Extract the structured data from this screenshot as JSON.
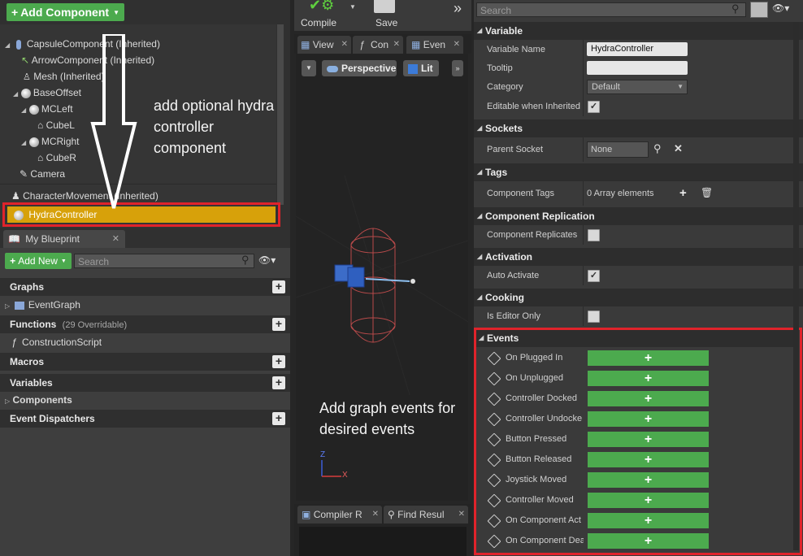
{
  "components_panel": {
    "add_component_label": "Add Component",
    "tree": [
      {
        "label": "CapsuleComponent (Inherited)",
        "icon": "capsule-icon"
      },
      {
        "label": "ArrowComponent (Inherited)",
        "icon": "arrow-icon"
      },
      {
        "label": "Mesh (Inherited)",
        "icon": "skeletal-mesh-icon"
      },
      {
        "label": "BaseOffset",
        "icon": "scene-icon"
      },
      {
        "label": "MCLeft",
        "icon": "motion-controller-icon"
      },
      {
        "label": "CubeL",
        "icon": "static-mesh-icon"
      },
      {
        "label": "MCRight",
        "icon": "motion-controller-icon"
      },
      {
        "label": "CubeR",
        "icon": "static-mesh-icon"
      },
      {
        "label": "Camera",
        "icon": "camera-icon"
      },
      {
        "label": "CharacterMovement (Inherited)",
        "icon": "movement-icon"
      },
      {
        "label": "HydraController",
        "icon": "hydra-icon",
        "selected": true
      }
    ]
  },
  "annotations": {
    "top": "add optional hydra controller component",
    "bottom": "Add graph events for desired events"
  },
  "my_blueprint": {
    "tab_label": "My Blueprint",
    "add_new_label": "Add New",
    "search_placeholder": "Search",
    "sections": {
      "graphs": "Graphs",
      "event_graph": "EventGraph",
      "functions": "Functions",
      "functions_count": "(29 Overridable)",
      "construction_script": "ConstructionScript",
      "macros": "Macros",
      "variables": "Variables",
      "components": "Components",
      "event_dispatchers": "Event Dispatchers"
    }
  },
  "toolbar": {
    "compile_label": "Compile",
    "save_label": "Save"
  },
  "viewport": {
    "tabs": [
      "View",
      "Con",
      "Even"
    ],
    "perspective_label": "Perspective",
    "lit_label": "Lit",
    "axis_z": "Z",
    "axis_x": "X"
  },
  "bottom_tabs": {
    "compiler_label": "Compiler R",
    "find_label": "Find Resul"
  },
  "details": {
    "search_placeholder": "Search",
    "variable": {
      "header": "Variable",
      "name_label": "Variable Name",
      "name_value": "HydraController",
      "tooltip_label": "Tooltip",
      "tooltip_value": "",
      "category_label": "Category",
      "category_value": "Default",
      "editable_label": "Editable when Inherited",
      "editable_checked": true
    },
    "sockets": {
      "header": "Sockets",
      "parent_socket_label": "Parent Socket",
      "parent_socket_value": "None"
    },
    "tags": {
      "header": "Tags",
      "component_tags_label": "Component Tags",
      "component_tags_value": "0 Array elements"
    },
    "replication": {
      "header": "Component Replication",
      "replicates_label": "Component Replicates",
      "replicates_checked": false
    },
    "activation": {
      "header": "Activation",
      "auto_activate_label": "Auto Activate",
      "auto_activate_checked": true
    },
    "cooking": {
      "header": "Cooking",
      "editor_only_label": "Is Editor Only",
      "editor_only_checked": false
    },
    "events": {
      "header": "Events",
      "items": [
        "On Plugged In",
        "On Unplugged",
        "Controller Docked",
        "Controller Undocke",
        "Button Pressed",
        "Button Released",
        "Joystick Moved",
        "Controller Moved",
        "On Component Act",
        "On Component Dea"
      ]
    }
  },
  "colors": {
    "highlight_red": "#e0232b",
    "selected_row": "#d7a10a",
    "green_button": "#4caa4e"
  }
}
